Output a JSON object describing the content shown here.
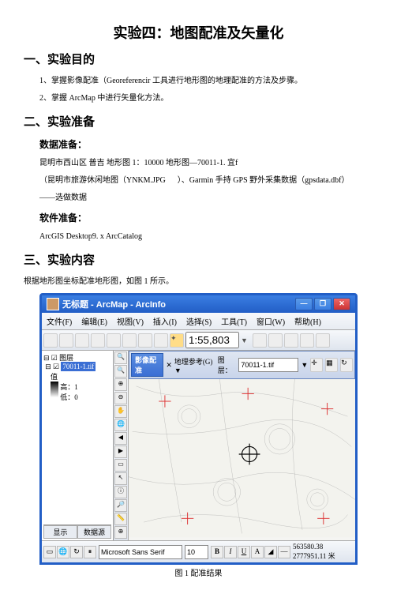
{
  "title": "实验四：地图配准及矢量化",
  "s1": {
    "h": "一、实验目的",
    "p1": "1、掌握影像配准（Georeferencir 工具进行地形图的地理配准的方法及步骤。",
    "p2": "2、掌握 ArcMap 中进行矢量化方法。"
  },
  "s2": {
    "h": "二、实验准备",
    "sub1": "数据准备：",
    "p1": "昆明市西山区 普吉 地形图 1：10000 地形图—70011-1. 宜f",
    "p2a": "（昆明市旅游休闲地图（YNKM.JPG",
    "p2b": "）、Garmin 手持 GPS 野外采集数据（gpsdata.dbf）",
    "p3": "——选做数据",
    "sub2": "软件准备：",
    "p4": "ArcGIS Desktop9. x ArcCatalog"
  },
  "s3": {
    "h": "三、实验内容",
    "p1": "根据地形图坐标配准地形图，如图 1 所示。",
    "caption": "图 1 配准结果"
  },
  "arcmap": {
    "title": "无标题 - ArcMap - ArcInfo",
    "menu": [
      "文件(F)",
      "编辑(E)",
      "视图(V)",
      "插入(I)",
      "选择(S)",
      "工具(T)",
      "窗口(W)",
      "帮助(H)"
    ],
    "scale": "1:55,803",
    "toc_title": "图层",
    "layer": "70011-1.tif",
    "layer_sub": "值",
    "layer_hi": "高：1",
    "layer_lo": "低：0",
    "toc_tabs": [
      "显示",
      "数据源"
    ],
    "georef": {
      "title": "影像配准",
      "label1": "地理参考(G) ▼",
      "label2": "图层：",
      "value": "70011-1.tif"
    },
    "font": "Microsoft Sans Serif",
    "fontsize": "10",
    "coords": "563580.38 2777951.11 米"
  }
}
